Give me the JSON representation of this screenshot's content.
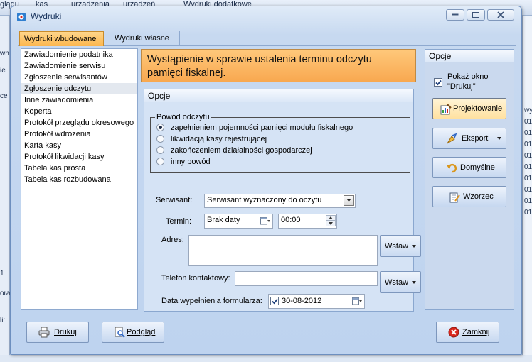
{
  "background": {
    "top_items": [
      "glądu",
      "kas",
      "urządzenia",
      "urządzeń",
      "Wydruki dodatkowe"
    ],
    "left_fragments": [
      "wn",
      "ie",
      "ce",
      "1",
      "ora",
      "li:"
    ],
    "right_fragments": [
      "wy",
      "01",
      "01",
      "01",
      "01",
      "01",
      "01",
      "01",
      "01",
      "01"
    ]
  },
  "window": {
    "title": "Wydruki"
  },
  "tabs": [
    {
      "label": "Wydruki wbudowane",
      "active": true
    },
    {
      "label": "Wydruki własne",
      "active": false
    }
  ],
  "reports": {
    "items": [
      "Zawiadomienie podatnika",
      "Zawiadomienie serwisu",
      "Zgłoszenie serwisantów",
      "Zgłoszenie odczytu",
      "Inne zawiadomienia",
      "Koperta",
      "Protokół przeglądu okresowego",
      "Protokół wdrożenia",
      "Karta kasy",
      "Protokół likwidacji kasy",
      "Tabela kas prosta",
      "Tabela kas rozbudowana"
    ],
    "selected_index": 3
  },
  "heading": {
    "line1": "Wystąpienie w sprawie ustalenia terminu odczytu",
    "line2": "pamięci fiskalnej."
  },
  "options": {
    "title": "Opcje",
    "reason_title": "Powód odczytu",
    "reasons": [
      "zapełnieniem pojemności pamięci modułu fiskalnego",
      "likwidacją kasy rejestrującej",
      "zakończeniem działalności gospodarczej",
      "inny powód"
    ],
    "selected_reason": 0,
    "serwisant_label": "Serwisant:",
    "serwisant_value": "Serwisant wyznaczony do oczytu",
    "termin_label": "Termin:",
    "termin_date": "Brak daty",
    "termin_time": "00:00",
    "adres_label": "Adres:",
    "adres_value": "",
    "wstaw_label": "Wstaw",
    "telefon_label": "Telefon kontaktowy:",
    "telefon_value": "",
    "data_label": "Data wypełnienia formularza:",
    "data_value": "30-08-2012",
    "data_checked": true
  },
  "side": {
    "title": "Opcje",
    "show_dialog_line1": "Pokaż okno",
    "show_dialog_line2": "\"Drukuj\"",
    "show_dialog_checked": true,
    "design_label": "Projektowanie",
    "export_label": "Eksport",
    "default_label": "Domyślne",
    "template_label": "Wzorzec"
  },
  "footer": {
    "print_label": "Drukuj",
    "preview_label": "Podgląd",
    "close_label": "Zamknij"
  },
  "colors": {
    "accent_orange": "#fbb64e",
    "panel_blue": "#c7d9f0",
    "close_red": "#d9261c"
  }
}
